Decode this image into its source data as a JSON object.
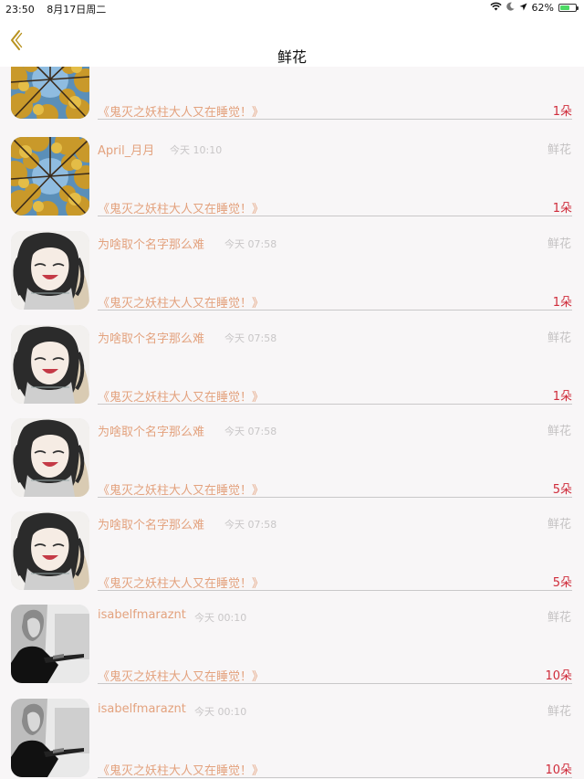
{
  "status_bar": {
    "time": "23:50",
    "date": "8月17日周二",
    "battery": "62%",
    "battery_level": 0.62,
    "icons": [
      "wifi-icon",
      "moon-icon",
      "location-arrow-icon",
      "battery-icon"
    ]
  },
  "nav": {
    "title": "鲜花",
    "back_icon": "chevron-left-icon"
  },
  "colors": {
    "accent": "#e3a27e",
    "count": "#cf2b3a",
    "muted": "#c4c2c3",
    "back": "#b8921e"
  },
  "rows": [
    {
      "user": "",
      "time": "",
      "type": "",
      "book": "《鬼灭之妖柱大人又在睡觉！》",
      "count": "1朵",
      "avatar": "forest-avatar"
    },
    {
      "user": "April_月月",
      "time": "今天 10:10",
      "type": "鲜花",
      "book": "《鬼灭之妖柱大人又在睡觉！》",
      "count": "1朵",
      "avatar": "forest-avatar"
    },
    {
      "user": "为啥取个名字那么难",
      "time": "今天 07:58",
      "type": "鲜花",
      "book": "《鬼灭之妖柱大人又在睡觉！》",
      "count": "1朵",
      "avatar": "anime-avatar"
    },
    {
      "user": "为啥取个名字那么难",
      "time": "今天 07:58",
      "type": "鲜花",
      "book": "《鬼灭之妖柱大人又在睡觉！》",
      "count": "1朵",
      "avatar": "anime-avatar"
    },
    {
      "user": "为啥取个名字那么难",
      "time": "今天 07:58",
      "type": "鲜花",
      "book": "《鬼灭之妖柱大人又在睡觉！》",
      "count": "5朵",
      "avatar": "anime-avatar"
    },
    {
      "user": "为啥取个名字那么难",
      "time": "今天 07:58",
      "type": "鲜花",
      "book": "《鬼灭之妖柱大人又在睡觉！》",
      "count": "5朵",
      "avatar": "anime-avatar"
    },
    {
      "user": "isabelfmaraznt",
      "time": "今天 00:10",
      "type": "鲜花",
      "book": "《鬼灭之妖柱大人又在睡觉！》",
      "count": "10朵",
      "avatar": "portrait-avatar"
    },
    {
      "user": "isabelfmaraznt",
      "time": "今天 00:10",
      "type": "鲜花",
      "book": "《鬼灭之妖柱大人又在睡觉！》",
      "count": "10朵",
      "avatar": "portrait-avatar"
    }
  ]
}
